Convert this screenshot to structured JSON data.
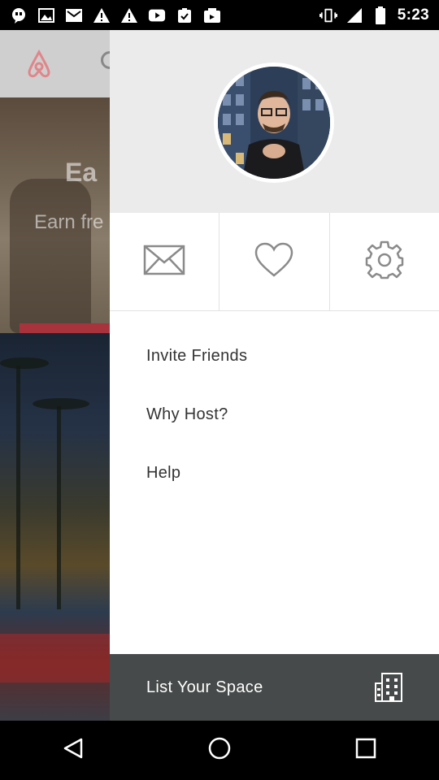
{
  "status_bar": {
    "time": "5:23",
    "left_icons": [
      "chat-bubble-icon",
      "image-icon",
      "mail-icon",
      "warning-icon",
      "warning-icon",
      "youtube-icon",
      "checklist-icon",
      "photo-icon"
    ],
    "right_icons": [
      "vibrate-icon",
      "signal-icon",
      "battery-icon"
    ]
  },
  "background_app": {
    "brand": "airbnb",
    "hero_title": "Ea",
    "hero_subtitle": "Earn fre"
  },
  "drawer": {
    "quick_actions": [
      {
        "name": "messages",
        "icon": "envelope-icon"
      },
      {
        "name": "wishlist",
        "icon": "heart-icon"
      },
      {
        "name": "settings",
        "icon": "gear-icon"
      }
    ],
    "menu": [
      {
        "label": "Invite Friends"
      },
      {
        "label": "Why Host?"
      },
      {
        "label": "Help"
      }
    ],
    "footer": {
      "label": "List Your Space",
      "icon": "building-icon"
    }
  },
  "nav_bar": {
    "buttons": [
      "back-icon",
      "home-icon",
      "recents-icon"
    ]
  },
  "colors": {
    "drawer_header_bg": "#ebebeb",
    "footer_bg": "#474a4a",
    "icon_gray": "#8a8a8a",
    "text": "#333333",
    "brand_red": "#ff5a5f"
  }
}
